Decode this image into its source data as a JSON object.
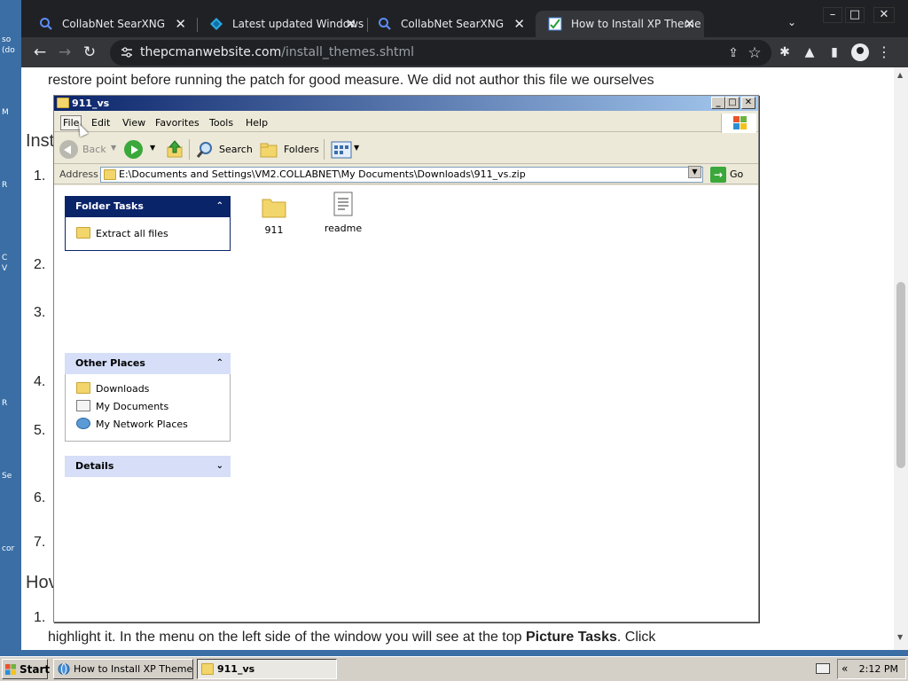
{
  "desktop": {
    "labels": [
      "so",
      "(do",
      "M",
      "R",
      "C",
      "V",
      "R",
      "Se",
      "cor"
    ]
  },
  "chrome": {
    "tabs": [
      {
        "title": "CollabNet SearXNG",
        "icon": "search-icon"
      },
      {
        "title": "Latest updated Windows",
        "icon": "diamond-icon"
      },
      {
        "title": "CollabNet SearXNG",
        "icon": "search-icon"
      },
      {
        "title": "How to Install XP Theme",
        "icon": "page-icon",
        "active": true
      }
    ],
    "tab_close": "✕",
    "tab_dropdown": "⌄",
    "window_controls": {
      "minimize": "–",
      "maximize": "□",
      "close": "✕"
    },
    "nav": {
      "back": "←",
      "forward": "→",
      "reload": "↻"
    },
    "url_host": "thepcmanwebsite.com",
    "url_path": "/install_themes.shtml",
    "omnibox_icons": {
      "share": "⇪",
      "bookmark": "☆"
    },
    "extension_icons": {
      "puzzle": "✱",
      "flask": "▲",
      "sidepanel": "▮",
      "menu": "⋮"
    }
  },
  "webpage": {
    "line_top": "restore point before running the patch for good measure. We did not author this file we ourselves",
    "heading1": "Inst",
    "heading2": "Hov",
    "numbers": [
      "1.",
      "2.",
      "3.",
      "4.",
      "5.",
      "6.",
      "7.",
      "1."
    ],
    "bottom_line_prefix": "highlight it. In the menu on the left side of the window you will see at the top ",
    "bottom_line_bold": "Picture Tasks",
    "bottom_line_suffix": ". Click"
  },
  "explorer": {
    "title": "911_vs",
    "title_buttons": {
      "minimize": "_",
      "maximize": "□",
      "close": "✕"
    },
    "menu": [
      "File",
      "Edit",
      "View",
      "Favorites",
      "Tools",
      "Help"
    ],
    "toolbar": {
      "back": "Back",
      "search": "Search",
      "folders": "Folders"
    },
    "address_label": "Address",
    "address_value": "E:\\Documents and Settings\\VM2.COLLABNET\\My Documents\\Downloads\\911_vs.zip",
    "go_label": "Go",
    "folder_tasks": {
      "header": "Folder Tasks",
      "chevron": "⌃",
      "items": [
        "Extract all files"
      ]
    },
    "other_places": {
      "header": "Other Places",
      "chevron": "⌃",
      "items": [
        "Downloads",
        "My Documents",
        "My Network Places"
      ]
    },
    "details": {
      "header": "Details",
      "chevron": "⌄"
    },
    "files": [
      {
        "name": "911",
        "icon": "folder-icon"
      },
      {
        "name": "readme",
        "icon": "text-file-icon"
      }
    ],
    "colors": {
      "panel_header_bg": "#d6dff7",
      "panel_header_dark": "#0a246a",
      "title_blue": "#0a246a"
    }
  },
  "taskbar": {
    "start": "Start",
    "items": [
      {
        "label": "How to Install XP Theme...",
        "icon": "browser-icon"
      },
      {
        "label": "911_vs",
        "icon": "folder-icon",
        "active": true
      }
    ],
    "tray_chevron": "«",
    "clock": "2:12 PM"
  }
}
